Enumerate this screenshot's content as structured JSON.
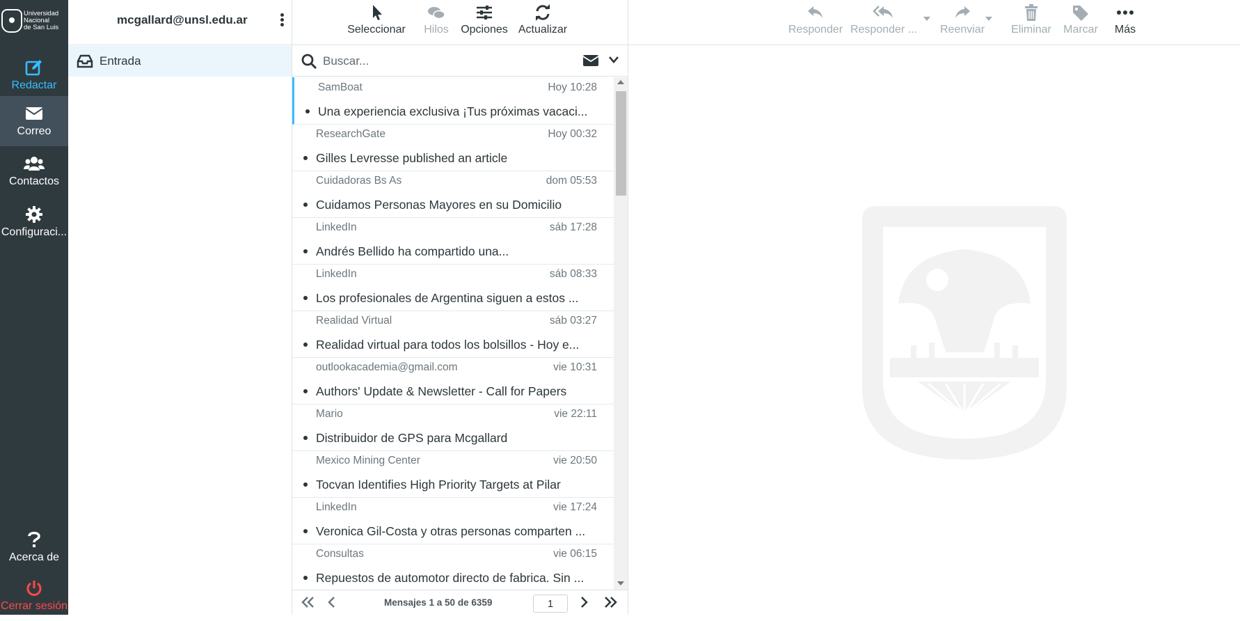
{
  "brand": {
    "logo_text": [
      "Universidad",
      "Nacional",
      "de San Luis"
    ],
    "accent": "#37beff",
    "sidebar_bg": "#2f3a3f",
    "danger": "#ff4949"
  },
  "sidebar": {
    "compose": "Redactar",
    "mail": "Correo",
    "contacts": "Contactos",
    "settings": "Configuraci...",
    "about": "Acerca de",
    "logout": "Cerrar sesión"
  },
  "account": {
    "email": "mcgallard@unsl.edu.ar"
  },
  "folders": [
    {
      "name": "Entrada",
      "selected": true
    }
  ],
  "list_toolbar": {
    "select": "Seleccionar",
    "threads": "Hilos",
    "options": "Opciones",
    "refresh": "Actualizar"
  },
  "search": {
    "placeholder": "Buscar...",
    "value": ""
  },
  "messages": [
    {
      "from": "SamBoat",
      "date": "Hoy 10:28",
      "subject": "Una experiencia exclusiva ¡Tus próximas vacaci..."
    },
    {
      "from": "ResearchGate",
      "date": "Hoy 00:32",
      "subject": "Gilles Levresse published an article"
    },
    {
      "from": "Cuidadoras Bs As",
      "date": "dom 05:53",
      "subject": "Cuidamos Personas Mayores en su Domicilio"
    },
    {
      "from": "LinkedIn",
      "date": "sáb 17:28",
      "subject": "Andrés Bellido ha compartido una..."
    },
    {
      "from": "LinkedIn",
      "date": "sáb 08:33",
      "subject": "Los profesionales de Argentina siguen a estos ..."
    },
    {
      "from": "Realidad Virtual",
      "date": "sáb 03:27",
      "subject": "Realidad virtual para todos los bolsillos - Hoy e..."
    },
    {
      "from": "outlookacademia@gmail.com",
      "date": "vie 10:31",
      "subject": "Authors' Update & Newsletter - Call for Papers"
    },
    {
      "from": "Mario",
      "date": "vie 22:11",
      "subject": "Distribuidor de GPS para Mcgallard"
    },
    {
      "from": "Mexico Mining Center",
      "date": "vie 20:50",
      "subject": "Tocvan Identifies High Priority Targets at Pilar"
    },
    {
      "from": "LinkedIn",
      "date": "vie 17:24",
      "subject": "Veronica Gil-Costa y otras personas comparten ..."
    },
    {
      "from": "Consultas",
      "date": "vie 06:15",
      "subject": "Repuestos de automotor directo de fabrica. Sin ..."
    }
  ],
  "pager": {
    "text": "Mensajes 1 a 50 de 6359",
    "page": "1"
  },
  "preview_toolbar": {
    "reply": "Responder",
    "reply_all": "Responder ...",
    "forward": "Reenviar",
    "delete": "Eliminar",
    "mark": "Marcar",
    "more": "Más"
  }
}
